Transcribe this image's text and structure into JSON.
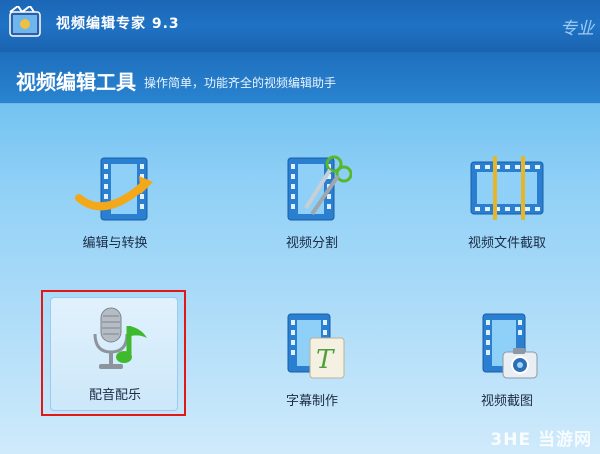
{
  "app": {
    "title": "视频编辑专家 9.3",
    "brand_tag": "专业"
  },
  "header": {
    "title": "视频编辑工具",
    "subtitle": "操作简单，功能齐全的视频编辑助手"
  },
  "tools": [
    {
      "label": "编辑与转换",
      "icon": "film-arrow-icon"
    },
    {
      "label": "视频分割",
      "icon": "film-scissors-icon"
    },
    {
      "label": "视频文件截取",
      "icon": "film-crop-icon"
    },
    {
      "label": "配音配乐",
      "icon": "microphone-music-icon"
    },
    {
      "label": "字幕制作",
      "icon": "film-subtitle-icon"
    },
    {
      "label": "视频截图",
      "icon": "film-camera-icon"
    }
  ],
  "watermark": "3HE 当游网",
  "colors": {
    "accent": "#1f72c4",
    "highlight": "#e01818"
  }
}
